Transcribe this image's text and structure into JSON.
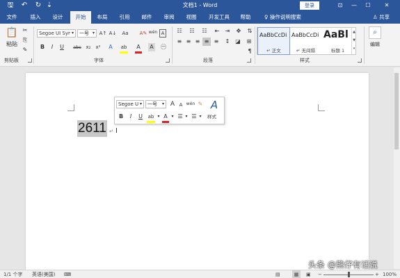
{
  "titlebar": {
    "quick_access": {
      "save": "🖫",
      "undo": "↶",
      "redo": "↻",
      "customize": "⇣"
    },
    "title": "文档1 - Word",
    "login": "登录",
    "window_buttons": {
      "ribbon_options": "⊡",
      "minimize": "—",
      "maximize": "☐",
      "close": "✕"
    }
  },
  "tabs": [
    "文件",
    "插入",
    "设计",
    "开始",
    "布局",
    "引用",
    "邮件",
    "审阅",
    "视图",
    "开发工具",
    "帮助"
  ],
  "active_tab": "开始",
  "tell_me": "♀ 操作说明搜索",
  "share": "♙ 共享",
  "ribbon": {
    "clipboard": {
      "paste_label": "粘贴",
      "group_label": "剪贴板"
    },
    "font": {
      "font_name": "Segoe UI Syr",
      "font_size": "一号",
      "bold": "B",
      "italic": "I",
      "underline": "U",
      "strike": "abc",
      "subscript": "x₂",
      "superscript": "x²",
      "grow": "A↑",
      "shrink": "A↓",
      "case": "Aa",
      "clear": "A✎",
      "phonetic": "wén",
      "border": "A",
      "effects": "A",
      "highlight": "ab",
      "color": "A",
      "shading": "A",
      "enclose": "㊀",
      "group_label": "字体"
    },
    "paragraph": {
      "group_label": "段落"
    },
    "styles": {
      "items": [
        {
          "sample": "AaBbCcDi",
          "name": "↵ 正文"
        },
        {
          "sample": "AaBbCcDi",
          "name": "↵ 无间隔"
        },
        {
          "sample": "AaBl",
          "name": "标题 1"
        }
      ],
      "group_label": "样式"
    },
    "editing": {
      "label": "编辑"
    }
  },
  "document": {
    "selected_text": "2611",
    "paragraph_mark": "↵",
    "cursor": "I"
  },
  "mini_toolbar": {
    "font_name": "Segoe U",
    "font_size": "一号",
    "grow": "A",
    "shrink": "A",
    "phonetic": "wén",
    "painter": "✎",
    "bold": "B",
    "italic": "I",
    "underline": "U",
    "highlight": "ab",
    "color": "A",
    "bullets": "☰",
    "numbering": "☰",
    "styles_label": "样式"
  },
  "status": {
    "page": "1/1 个字",
    "language": "英语(美国)",
    "macro": "⌨",
    "zoom": "100%"
  },
  "watermark": "头条 @熊仔有话说"
}
